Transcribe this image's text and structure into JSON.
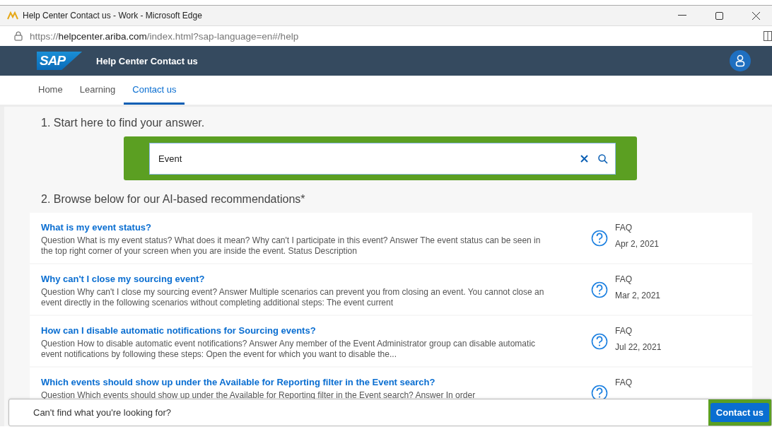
{
  "window": {
    "title": "Help Center Contact us - Work - Microsoft Edge"
  },
  "address_bar": {
    "url_prefix": "https://",
    "url_domain": "helpcenter.ariba.com",
    "url_path": "/index.html?sap-language=en#/help"
  },
  "header": {
    "logo": "SAP",
    "title": "Help Center Contact us"
  },
  "tabs": [
    {
      "label": "Home",
      "selected": false
    },
    {
      "label": "Learning",
      "selected": false
    },
    {
      "label": "Contact us",
      "selected": true
    }
  ],
  "step_1": "1. Start here to find your answer.",
  "search": {
    "value": "Event",
    "highlighted": true
  },
  "step_2": "2. Browse below for our AI-based recommendations*",
  "results": [
    {
      "title": "What is my event status?",
      "snippet": "Question What is my event status? What does it mean? Why can't I participate in this event? Answer The event status can be seen in the top right corner of your screen when you are inside the event. Status Description",
      "type": "FAQ",
      "date": "Apr 2, 2021"
    },
    {
      "title": "Why can't I close my sourcing event?",
      "snippet": "Question Why can't I close my sourcing event? Answer Multiple scenarios can prevent you from closing an event. You cannot close an event directly in the following scenarios without completing additional steps: The event current",
      "type": "FAQ",
      "date": "Mar 2, 2021"
    },
    {
      "title": "How can I disable automatic notifications for Sourcing events?",
      "snippet": "Question How to disable automatic event notifications? Answer Any member of the Event Administrator group can disable automatic event notifications by following these steps: Open the event for which you want to disable the...",
      "type": "FAQ",
      "date": "Jul 22, 2021"
    },
    {
      "title": "Which events should show up under the Available for Reporting filter in the Event search?",
      "snippet": "Question Which events should show up under the Available for Reporting filter in the Event search? Answer In order",
      "type": "FAQ"
    }
  ],
  "footer": {
    "text": "Can't find what you're looking for?",
    "button": "Contact us",
    "button_highlighted": true
  }
}
